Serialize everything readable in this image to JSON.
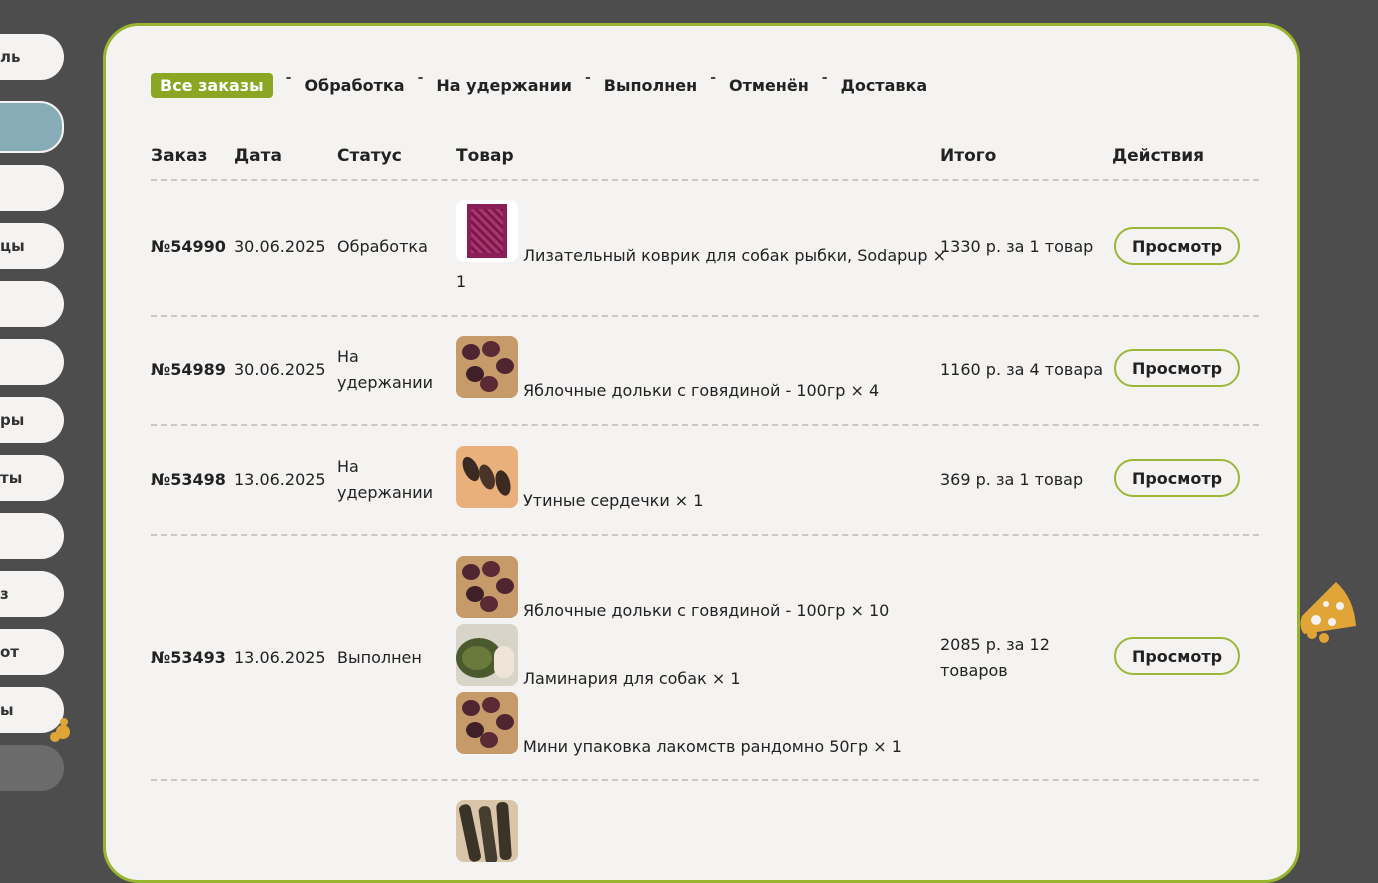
{
  "sidebar": {
    "items": [
      {
        "label": "ль"
      },
      {
        "label": ""
      },
      {
        "label": ""
      },
      {
        "label": "цы"
      },
      {
        "label": ""
      },
      {
        "label": ""
      },
      {
        "label": "ры"
      },
      {
        "label": "ты"
      },
      {
        "label": ""
      },
      {
        "label": "з"
      },
      {
        "label": "от"
      },
      {
        "label": "ы"
      },
      {
        "label": ""
      }
    ]
  },
  "tabs": [
    {
      "label": "Все заказы"
    },
    {
      "label": "Обработка"
    },
    {
      "label": "На удержании"
    },
    {
      "label": "Выполнен"
    },
    {
      "label": "Отменён"
    },
    {
      "label": "Доставка"
    }
  ],
  "tab_separator": "-",
  "table": {
    "headers": {
      "order": "Заказ",
      "date": "Дата",
      "status": "Статус",
      "product": "Товар",
      "total": "Итого",
      "actions": "Действия"
    },
    "rows": [
      {
        "order": "№54990",
        "date": "30.06.2025",
        "status": "Обработка",
        "products": [
          {
            "name": "Лизательный коврик для собак рыбки, Sodapup ×",
            "qty_line": "1"
          }
        ],
        "total": "1330 р. за 1 товар",
        "action": "Просмотр"
      },
      {
        "order": "№54989",
        "date": "30.06.2025",
        "status": "На удержании",
        "products": [
          {
            "name": "Яблочные дольки с говядиной - 100гр × 4"
          }
        ],
        "total": "1160 р. за 4 товара",
        "action": "Просмотр"
      },
      {
        "order": "№53498",
        "date": "13.06.2025",
        "status": "На удержании",
        "products": [
          {
            "name": "Утиные сердечки × 1"
          }
        ],
        "total": "369 р. за 1 товар",
        "action": "Просмотр"
      },
      {
        "order": "№53493",
        "date": "13.06.2025",
        "status": "Выполнен",
        "products": [
          {
            "name": "Яблочные дольки с говядиной - 100гр × 10"
          },
          {
            "name": "Ламинария для собак × 1"
          },
          {
            "name": "Мини упаковка лакомств рандомно 50гр × 1"
          }
        ],
        "total": "2085 р. за 12 товаров",
        "action": "Просмотр"
      }
    ]
  },
  "colors": {
    "background": "#4d4d4d",
    "panel": "#f4f3f1",
    "accent_green": "#97b52e",
    "active_tab": "#8aa622",
    "sidebar_active": "#86adb7",
    "cheese": "#e1a437"
  },
  "icons": [
    "cheese-icon",
    "paw-icon"
  ]
}
